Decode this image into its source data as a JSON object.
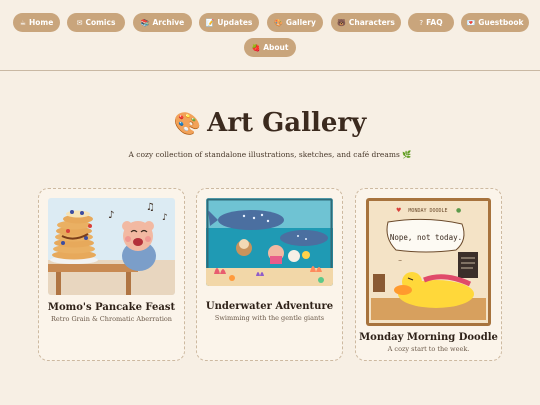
{
  "nav": {
    "items": [
      {
        "icon": "☕",
        "label": "Home"
      },
      {
        "icon": "✉",
        "label": "Comics"
      },
      {
        "icon": "📚",
        "label": "Archive"
      },
      {
        "icon": "📝",
        "label": "Updates"
      },
      {
        "icon": "🎨",
        "label": "Gallery"
      },
      {
        "icon": "🐻",
        "label": "Characters"
      },
      {
        "icon": "?",
        "label": "FAQ"
      },
      {
        "icon": "💌",
        "label": "Guestbook"
      },
      {
        "icon": "🍓",
        "label": "About"
      }
    ]
  },
  "header": {
    "icon": "🎨",
    "title": "Art Gallery",
    "subtitle": "A cozy collection of standalone illustrations, sketches, and café dreams 🌿"
  },
  "gallery": {
    "cards": [
      {
        "title": "Momo's Pancake Feast",
        "subtitle": "Retro Grain & Chromatic Aberration"
      },
      {
        "title": "Underwater Adventure",
        "subtitle": "Swimming with the gentle giants"
      },
      {
        "title": "Monday Morning Doodle",
        "subtitle": "A cozy start to the week.",
        "art": {
          "header": "MONDAY DOODLE",
          "bubble": "Nope, not today."
        }
      }
    ]
  },
  "colors": {
    "background": "#f7efe4",
    "pill": "#c9a57c",
    "text": "#3b2a1e"
  }
}
